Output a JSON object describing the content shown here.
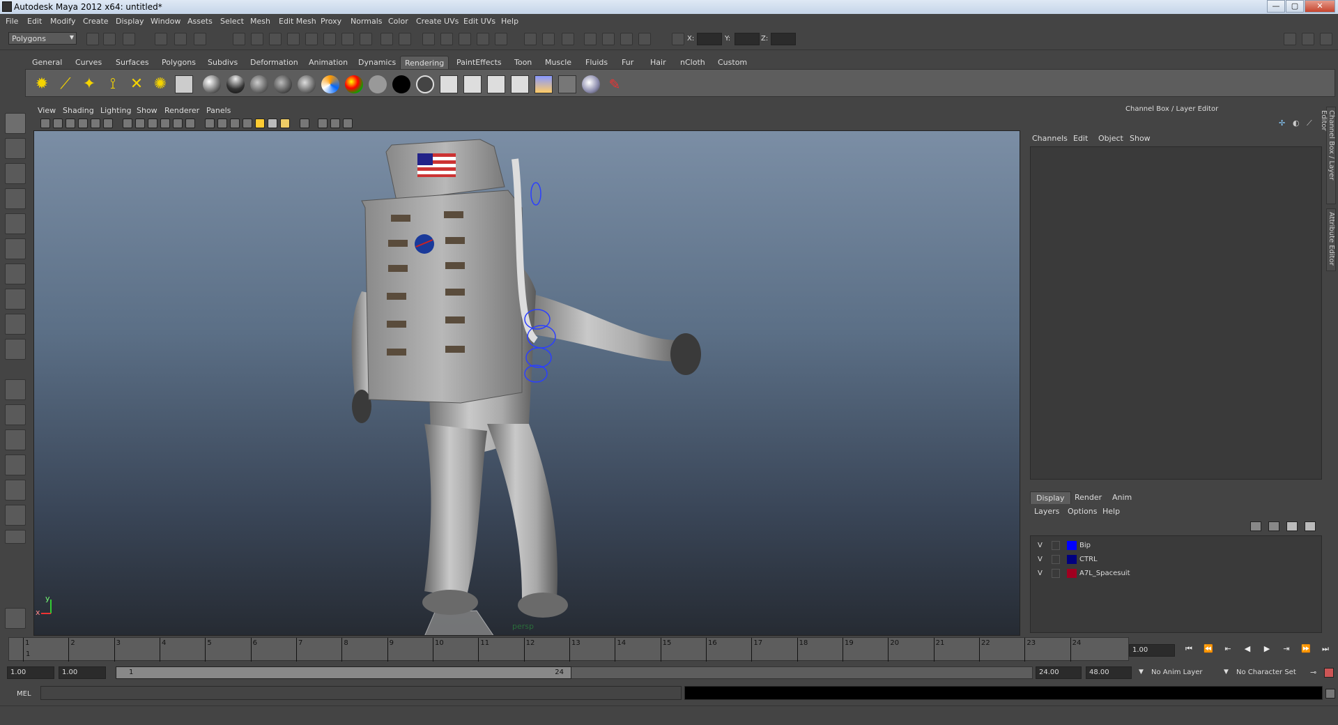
{
  "window": {
    "title": "Autodesk Maya 2012 x64: untitled*",
    "min_label": "—",
    "max_label": "▢",
    "close_label": "✕"
  },
  "menus": [
    "File",
    "Edit",
    "Modify",
    "Create",
    "Display",
    "Window",
    "Assets",
    "Select",
    "Mesh",
    "Edit Mesh",
    "Proxy",
    "Normals",
    "Color",
    "Create UVs",
    "Edit UVs",
    "Help"
  ],
  "statusline": {
    "mode": "Polygons",
    "x_label": "X:",
    "y_label": "Y:",
    "z_label": "Z:"
  },
  "shelf_tabs": [
    "General",
    "Curves",
    "Surfaces",
    "Polygons",
    "Subdivs",
    "Deformation",
    "Animation",
    "Dynamics",
    "Rendering",
    "PaintEffects",
    "Toon",
    "Muscle",
    "Fluids",
    "Fur",
    "Hair",
    "nCloth",
    "Custom"
  ],
  "active_shelf_tab": "Rendering",
  "viewport": {
    "menus": [
      "View",
      "Shading",
      "Lighting",
      "Show",
      "Renderer",
      "Panels"
    ],
    "camera_label": "persp",
    "axis_y": "y",
    "axis_x": "x"
  },
  "channel_box": {
    "title": "Channel Box / Layer Editor",
    "menus": [
      "Channels",
      "Edit",
      "Object",
      "Show"
    ]
  },
  "side_tabs": [
    "Channel Box / Layer Editor",
    "Attribute Editor"
  ],
  "layer_editor": {
    "tabs": [
      "Display",
      "Render",
      "Anim"
    ],
    "active_tab": "Display",
    "menus": [
      "Layers",
      "Options",
      "Help"
    ],
    "layers": [
      {
        "visible": "V",
        "name": "Bip",
        "color": "#0000ff"
      },
      {
        "visible": "V",
        "name": "CTRL",
        "color": "#000080"
      },
      {
        "visible": "V",
        "name": "A7L_Spacesuit",
        "color": "#a00020"
      }
    ]
  },
  "timeslider": {
    "ticks": [
      "1",
      "2",
      "3",
      "4",
      "5",
      "6",
      "7",
      "8",
      "9",
      "10",
      "11",
      "12",
      "13",
      "14",
      "15",
      "16",
      "17",
      "18",
      "19",
      "20",
      "21",
      "22",
      "23",
      "24"
    ],
    "current_marker": "1",
    "current_frame": "1.00"
  },
  "range": {
    "start": "1.00",
    "anim_start": "1.00",
    "handle_start": "1",
    "handle_end": "24",
    "end": "24.00",
    "anim_end": "48.00",
    "anim_layer": "No Anim Layer",
    "character_set": "No Character Set"
  },
  "command_line": {
    "label": "MEL"
  }
}
